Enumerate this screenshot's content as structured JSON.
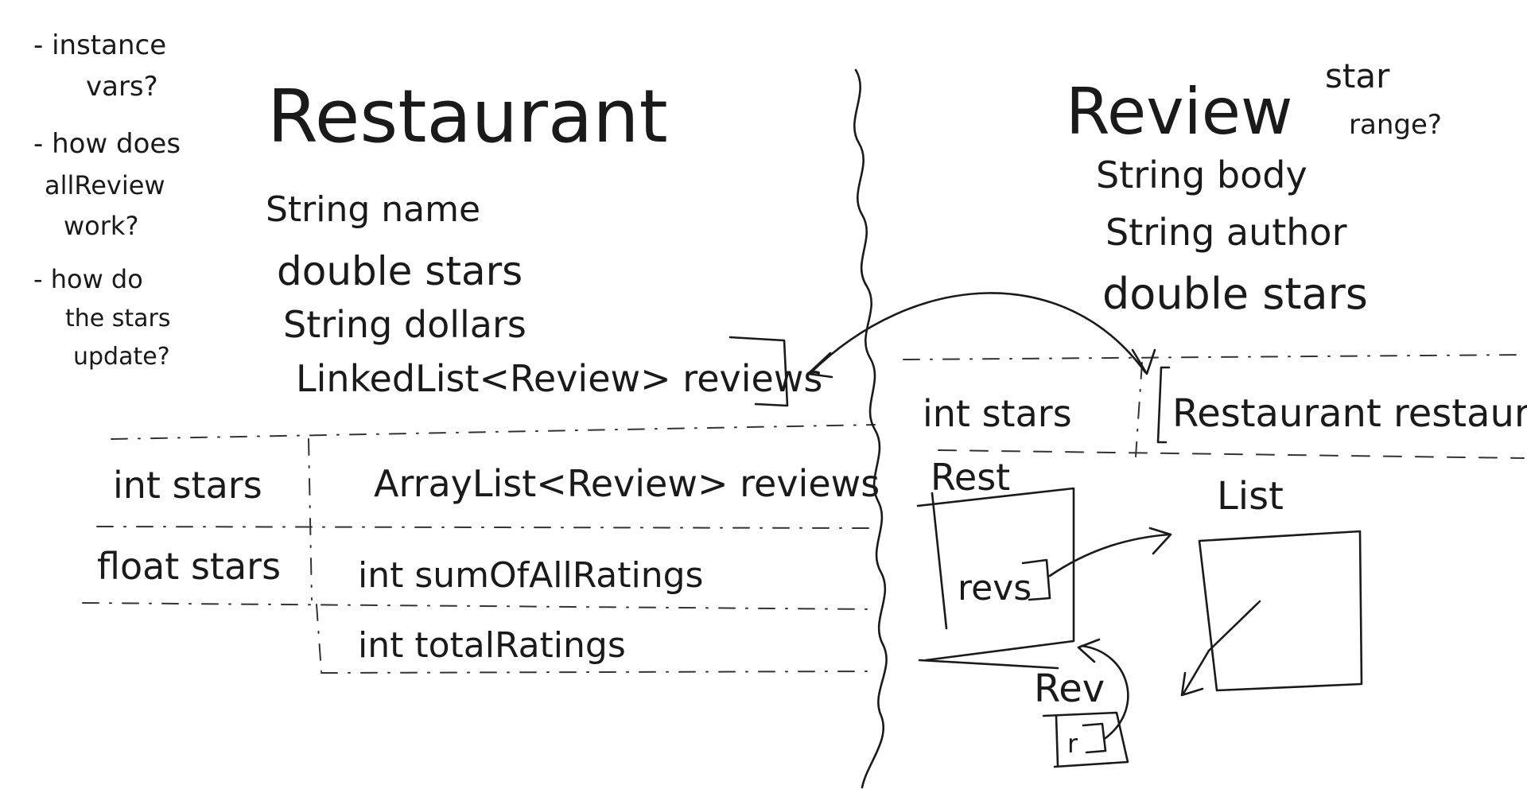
{
  "notes": {
    "line1a": "- instance",
    "line1b": "vars?",
    "line2a": "- how does",
    "line2b": "allReview",
    "line2c": "work?",
    "line3a": "- how do",
    "line3b": "the stars",
    "line3c": "update?"
  },
  "restaurant": {
    "title": "Restaurant",
    "fields": [
      "String name",
      "double stars",
      "String dollars",
      "LinkedList<Review> reviews"
    ]
  },
  "restaurant_options": {
    "stars_int": "int stars",
    "stars_float": "float stars",
    "reviews_list": "ArrayList<Review> reviews",
    "sum_field": "int sumOfAllRatings",
    "total_field": "int totalRatings"
  },
  "review": {
    "title": "Review",
    "note_a": "star",
    "note_b": "range?",
    "fields": [
      "String body",
      "String author",
      "double stars"
    ]
  },
  "review_options": {
    "stars_int": "int stars",
    "restaurant_field": "Restaurant restaurant"
  },
  "memory_diagram": {
    "rest_label": "Rest",
    "revs_label": "revs",
    "list_label": "List",
    "rev_label": "Rev",
    "r_label": "r"
  }
}
